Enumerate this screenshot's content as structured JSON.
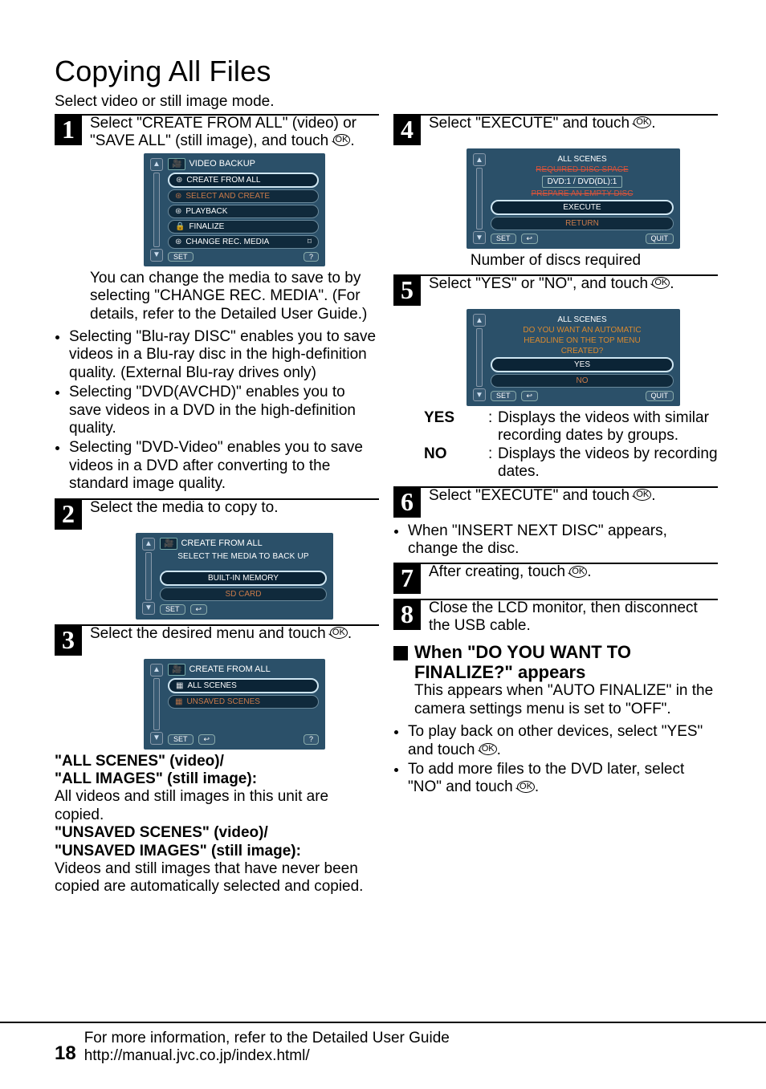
{
  "title": "Copying All Files",
  "intro": "Select video or still image mode.",
  "steps": {
    "s1": {
      "num": "1",
      "text_a": "Select \"CREATE FROM ALL\" (video) or \"SAVE ALL\" (still image), and touch ",
      "text_b": "."
    },
    "lcd1": {
      "header": "VIDEO BACKUP",
      "items": [
        "CREATE FROM ALL",
        "SELECT AND CREATE",
        "PLAYBACK",
        "FINALIZE",
        "CHANGE REC. MEDIA"
      ],
      "foot_set": "SET",
      "foot_q": "?"
    },
    "note1": "You can change the media to save to by selecting \"CHANGE REC. MEDIA\". (For details, refer to the Detailed User Guide.)",
    "bullets1": [
      "Selecting \"Blu-ray DISC\" enables you to save videos in a Blu-ray disc in the high-definition quality. (External Blu-ray drives only)",
      "Selecting \"DVD(AVCHD)\" enables you to save videos in a DVD in the high-definition quality.",
      "Selecting \"DVD-Video\" enables you to save videos in a DVD after converting to the standard image quality."
    ],
    "s2": {
      "num": "2",
      "text": "Select the media to copy to."
    },
    "lcd2": {
      "header": "CREATE FROM ALL",
      "msg": "SELECT THE MEDIA TO BACK UP",
      "items": [
        "BUILT-IN MEMORY",
        "SD CARD"
      ],
      "foot_set": "SET",
      "foot_back": "↩"
    },
    "s3": {
      "num": "3",
      "text_a": "Select the desired menu and touch ",
      "text_b": "."
    },
    "lcd3": {
      "header": "CREATE FROM ALL",
      "items": [
        "ALL SCENES",
        "UNSAVED SCENES"
      ],
      "foot_set": "SET",
      "foot_back": "↩",
      "foot_q": "?"
    },
    "defs": {
      "h1": "\"ALL SCENES\" (video)/",
      "h1b": "\"ALL IMAGES\" (still image):",
      "b1": "All videos and still images in this unit are copied.",
      "h2": "\"UNSAVED SCENES\" (video)/",
      "h2b": "\"UNSAVED IMAGES\" (still image):",
      "b2": "Videos and still images that have never been copied are automatically selected and copied."
    },
    "s4": {
      "num": "4",
      "text_a": "Select \"EXECUTE\" and touch ",
      "text_b": "."
    },
    "lcd4": {
      "title": "ALL SCENES",
      "line1": "REQUIRED DISC SPACE",
      "dvd": "DVD:1 / DVD(DL):1",
      "line2": "PREPARE AN EMPTY DISC",
      "items": [
        "EXECUTE",
        "RETURN"
      ],
      "foot_set": "SET",
      "foot_back": "↩",
      "foot_quit": "QUIT"
    },
    "caption4": "Number of discs required",
    "s5": {
      "num": "5",
      "text_a": "Select \"YES\" or \"NO\", and touch ",
      "text_b": "."
    },
    "lcd5": {
      "title": "ALL SCENES",
      "msg1": "DO YOU WANT AN AUTOMATIC",
      "msg2": "HEADLINE ON THE TOP MENU",
      "msg3": "CREATED?",
      "items": [
        "YES",
        "NO"
      ],
      "foot_set": "SET",
      "foot_back": "↩",
      "foot_quit": "QUIT"
    },
    "yn": {
      "yes_k": "YES",
      "yes_v": "Displays the videos with similar recording dates by groups.",
      "no_k": "NO",
      "no_v": "Displays the videos by recording dates."
    },
    "s6": {
      "num": "6",
      "text_a": "Select \"EXECUTE\" and touch ",
      "text_b": "."
    },
    "bullet6": "When \"INSERT NEXT DISC\" appears, change the disc.",
    "s7": {
      "num": "7",
      "text_a": "After creating, touch ",
      "text_b": "."
    },
    "s8": {
      "num": "8",
      "text": "Close the LCD monitor, then disconnect the USB cable."
    },
    "sub": {
      "title": "When \"DO YOU WANT TO FINALIZE?\" appears",
      "p": "This appears when \"AUTO FINALIZE\" in the camera settings menu is set to \"OFF\".",
      "b1_a": "To play back on other devices, select \"YES\" and touch ",
      "b1_b": ".",
      "b2_a": "To add more files to the DVD later, select \"NO\" and touch ",
      "b2_b": "."
    }
  },
  "footer": {
    "page": "18",
    "line1": "For more information, refer to the Detailed User Guide",
    "line2": "http://manual.jvc.co.jp/index.html/"
  }
}
